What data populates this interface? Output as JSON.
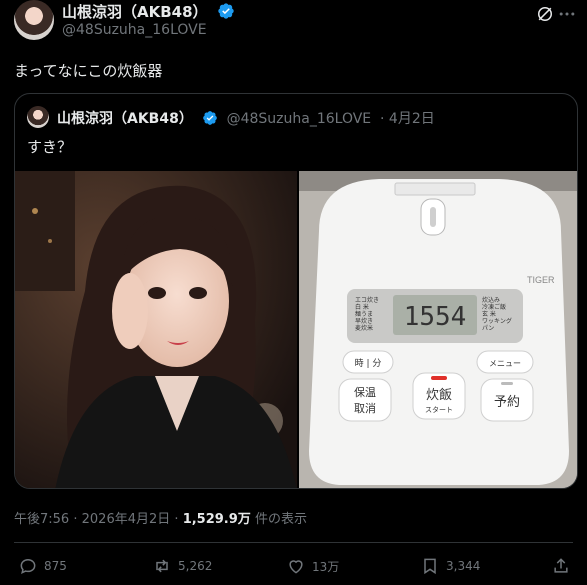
{
  "post": {
    "author_name": "山根涼羽（AKB48）",
    "handle": "@48Suzuha_16LOVE",
    "text": "まってなにこの炊飯器"
  },
  "quoted": {
    "author_name": "山根涼羽（AKB48）",
    "handle": "@48Suzuha_16LOVE",
    "date": "· 4月2日",
    "text": "すき？",
    "cooker": {
      "brand": "TIGER",
      "display_time": "1554",
      "left_menu": [
        "エコ炊き",
        "白 米",
        "麺うま",
        "早炊き",
        "麦炊米"
      ],
      "right_menu": [
        "炊込み",
        "冷凍ご飯",
        "玄 米",
        "ワッキング",
        "パン"
      ],
      "btn_time": "時 | 分",
      "btn_menu": "メニュー",
      "btn_keep": [
        "保温",
        "取消"
      ],
      "btn_cook": "炊飯",
      "btn_cook_sub": "スタート",
      "btn_reserve": "予約"
    }
  },
  "meta": {
    "time": "午後7:56",
    "sep": "·",
    "date": "2026年4月2日",
    "views": "1,529.9万",
    "views_label": "件の表示"
  },
  "actions": {
    "replies": "875",
    "reposts": "5,262",
    "likes": "13万",
    "bookmarks": "3,344"
  },
  "colors": {
    "verified": "#1d9bf0",
    "text": "#e7e9ea",
    "muted": "#71767b",
    "border": "#2f3336"
  }
}
